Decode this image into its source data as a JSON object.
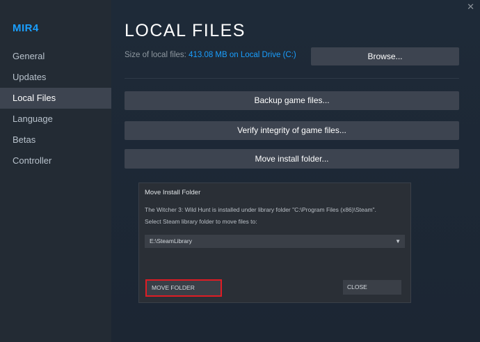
{
  "sidebar": {
    "app_title": "MIR4",
    "items": [
      {
        "label": "General"
      },
      {
        "label": "Updates"
      },
      {
        "label": "Local Files"
      },
      {
        "label": "Language"
      },
      {
        "label": "Betas"
      },
      {
        "label": "Controller"
      }
    ],
    "active_item": "Local Files"
  },
  "window": {
    "close_glyph": "✕"
  },
  "main": {
    "title": "LOCAL FILES",
    "size_label": "Size of local files:",
    "size_value": "413.08 MB on Local Drive (C:)",
    "browse_label": "Browse...",
    "backup_label": "Backup game files...",
    "verify_label": "Verify integrity of game files...",
    "move_label": "Move install folder..."
  },
  "dialog": {
    "title": "Move Install Folder",
    "line1": "The Witcher 3: Wild Hunt is installed under library folder \"C:\\Program Files (x86)\\Steam\".",
    "line2": "Select Steam library folder to move files to:",
    "select_value": "E:\\SteamLibrary",
    "move_folder_label": "MOVE FOLDER",
    "close_label": "CLOSE"
  },
  "colors": {
    "accent": "#1a9fff",
    "highlight_border": "#e01c24"
  }
}
